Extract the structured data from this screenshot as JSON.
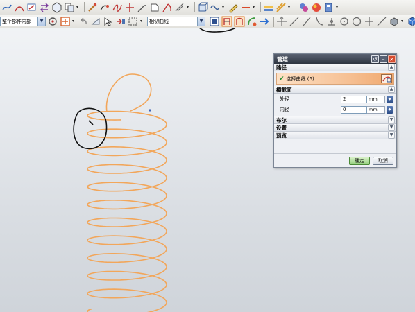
{
  "toolbar1": {
    "icons": [
      "spline-icon",
      "curve-icon",
      "sketch-icon",
      "swap-icon",
      "hex-icon",
      "copy-icon",
      "brush-icon",
      "pin-icon",
      "knot-icon",
      "plus-icon",
      "arc-icon",
      "box-outline-icon",
      "slash-curve-icon",
      "grid-icon",
      "cube-move-icon",
      "chain-icon",
      "pen-icon",
      "minus-icon",
      "layers-icon",
      "palette-icon",
      "color-ball-icon",
      "drop-icon"
    ]
  },
  "toolbar2": {
    "filter_value": "整个部件内部",
    "curve_rule_value": "相切曲线",
    "icons": [
      "snap-icon",
      "filter-icon",
      "undo-icon",
      "select-icon",
      "arrow-icon",
      "box-select-icon",
      "mask-icon",
      "highlighted-tool-a-icon",
      "highlighted-tool-b-icon",
      "bend-icon",
      "arrow-right-icon",
      "line-icon",
      "slash-icon",
      "curve-point-icon",
      "circle-point-icon",
      "circle-icon",
      "cross-icon",
      "minus-line-icon",
      "cube-icon",
      "view-icon"
    ]
  },
  "dialog": {
    "title": "管道",
    "path_section": "路径",
    "select_curve": "选择曲线 (6)",
    "cross_section": "横截面",
    "outer_label": "外径",
    "outer_value": "2",
    "outer_unit": "mm",
    "inner_label": "内径",
    "inner_value": "0",
    "inner_unit": "mm",
    "boolean_section": "布尔",
    "settings_section": "设置",
    "preview_section": "预览",
    "ok_label": "确定",
    "cancel_label": "取消"
  },
  "colors": {
    "helix": "#f2a65a",
    "annotation": "#111111",
    "selection": "#f0a86e"
  }
}
